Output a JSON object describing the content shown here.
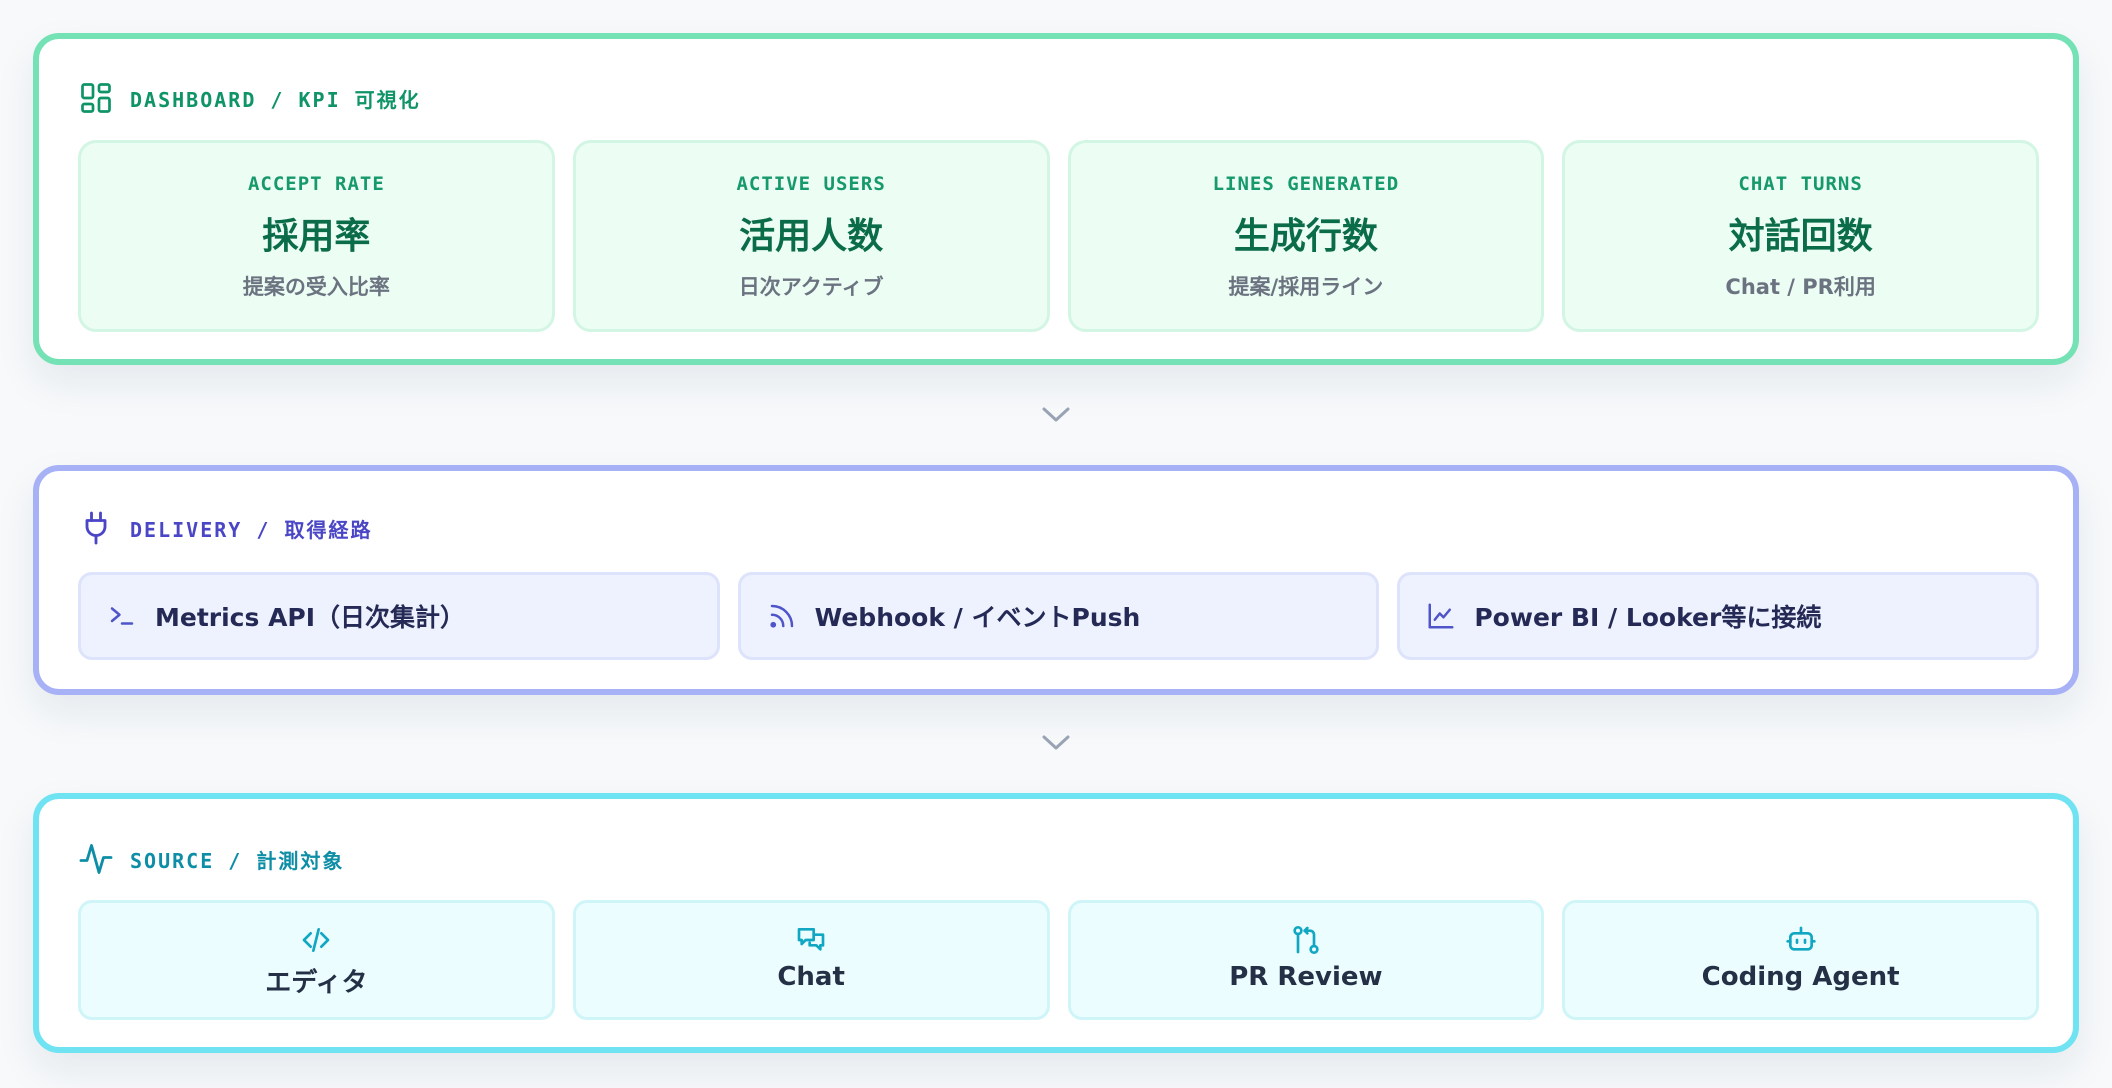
{
  "dashboard": {
    "title": "DASHBOARD / KPI 可視化",
    "icon": "dashboard-grid-icon",
    "cards": [
      {
        "label": "ACCEPT RATE",
        "title": "採用率",
        "sub": "提案の受入比率"
      },
      {
        "label": "ACTIVE USERS",
        "title": "活用人数",
        "sub": "日次アクティブ"
      },
      {
        "label": "LINES GENERATED",
        "title": "生成行数",
        "sub": "提案/採用ライン"
      },
      {
        "label": "CHAT TURNS",
        "title": "対話回数",
        "sub": "Chat / PR利用"
      }
    ]
  },
  "delivery": {
    "title": "DELIVERY / 取得経路",
    "icon": "plug-icon",
    "items": [
      {
        "label": "Metrics API（日次集計）",
        "icon": "terminal-icon"
      },
      {
        "label": "Webhook / イベントPush",
        "icon": "rss-icon"
      },
      {
        "label": "Power BI / Looker等に接続",
        "icon": "line-chart-icon"
      }
    ]
  },
  "source": {
    "title": "SOURCE / 計測対象",
    "icon": "activity-icon",
    "items": [
      {
        "label": "エディタ",
        "icon": "code-icon"
      },
      {
        "label": "Chat",
        "icon": "chat-bubbles-icon"
      },
      {
        "label": "PR Review",
        "icon": "git-pull-request-icon"
      },
      {
        "label": "Coding Agent",
        "icon": "bot-icon"
      }
    ]
  },
  "colors": {
    "green": "#74e2b4",
    "indigo": "#a7b2f6",
    "cyan": "#6fe3f1"
  }
}
